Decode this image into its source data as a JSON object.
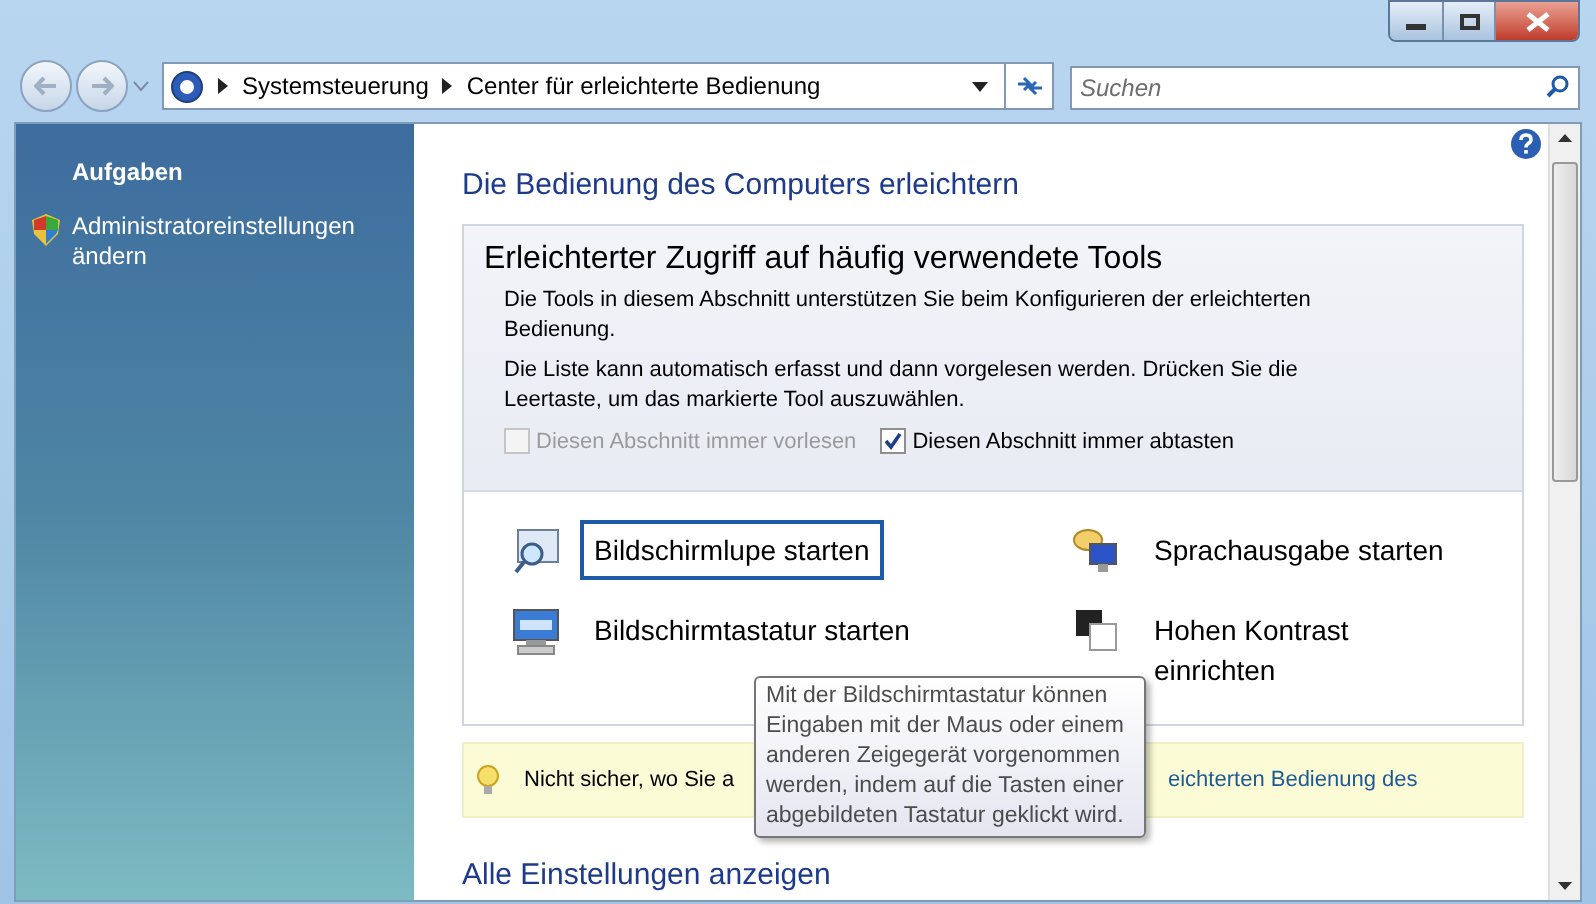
{
  "breadcrumbs": [
    "Systemsteuerung",
    "Center für erleichterte Bedienung"
  ],
  "search": {
    "placeholder": "Suchen"
  },
  "sidebar": {
    "heading": "Aufgaben",
    "items": [
      {
        "label": "Administratoreinstellungen ändern"
      }
    ]
  },
  "heading": "Die Bedienung des Computers erleichtern",
  "section": {
    "title": "Erleichterter Zugriff auf häufig verwendete Tools",
    "paragraphs": [
      "Die Tools in diesem Abschnitt unterstützen Sie beim Konfigurieren der erleichterten Bedienung.",
      "Die Liste kann automatisch erfasst und dann vorgelesen werden. Drücken Sie die Leertaste, um das markierte Tool auszuwählen."
    ],
    "options": [
      {
        "label": "Diesen Abschnitt immer vorlesen",
        "checked": false,
        "disabled": true
      },
      {
        "label": "Diesen Abschnitt immer abtasten",
        "checked": true,
        "disabled": false
      }
    ],
    "tools": [
      {
        "kind": "magnifier",
        "label": "Bildschirmlupe starten",
        "selected": true
      },
      {
        "kind": "narrator",
        "label": "Sprachausgabe starten",
        "selected": false
      },
      {
        "kind": "keyboard",
        "label": "Bildschirmtastatur starten",
        "selected": false
      },
      {
        "kind": "contrast",
        "label": "Hohen Kontrast einrichten",
        "selected": false
      }
    ]
  },
  "hint": {
    "text": "Nicht sicher, wo Sie a",
    "link": "eichterten Bedienung des"
  },
  "tooltip": "Mit der Bildschirmtastatur können Eingaben mit der Maus oder einem anderen Zeigegerät vorgenommen werden, indem auf die Tasten einer abgebildeten Tastatur geklickt wird.",
  "all_settings": "Alle Einstellungen anzeigen"
}
